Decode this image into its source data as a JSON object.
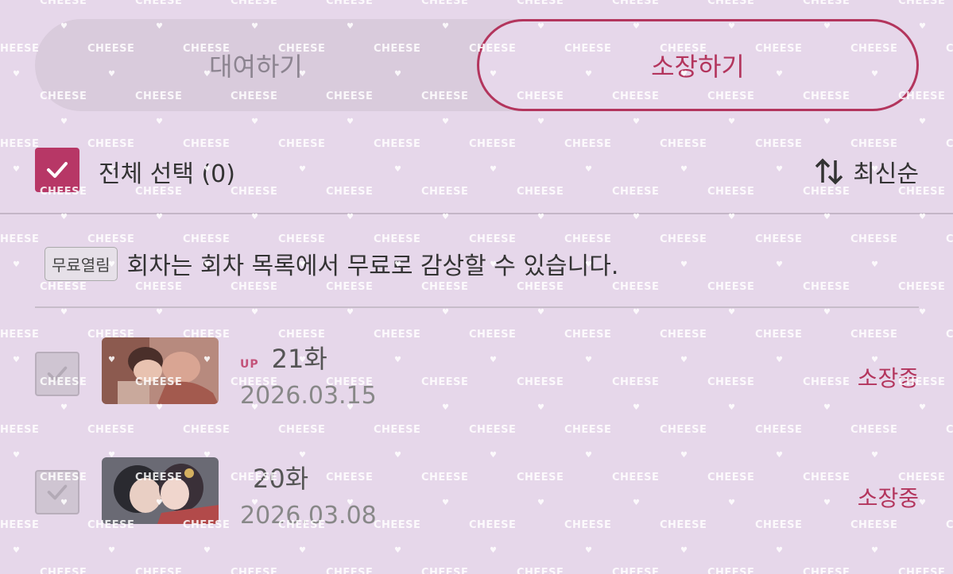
{
  "tabs": {
    "rent_label": "대여하기",
    "own_label": "소장하기",
    "active": "own"
  },
  "select_bar": {
    "select_all_label": "전체 선택 (0)",
    "sort_label": "최신순",
    "checkbox_icon": "check-icon",
    "sort_icon": "sort-arrows-icon"
  },
  "notice": {
    "badge": "무료열림",
    "text": "회차는 회차 목록에서 무료로 감상할 수 있습니다."
  },
  "episodes": [
    {
      "badge": "UP",
      "title": "21화",
      "date": "2026.03.15",
      "status": "소장중"
    },
    {
      "badge": "",
      "title": "20화",
      "date": "2026.03.08",
      "status": "소장중"
    }
  ],
  "watermark": "CHEESE",
  "colors": {
    "background": "#e6d7ea",
    "accent": "#b3355d",
    "checkbox_active": "#b73766"
  }
}
